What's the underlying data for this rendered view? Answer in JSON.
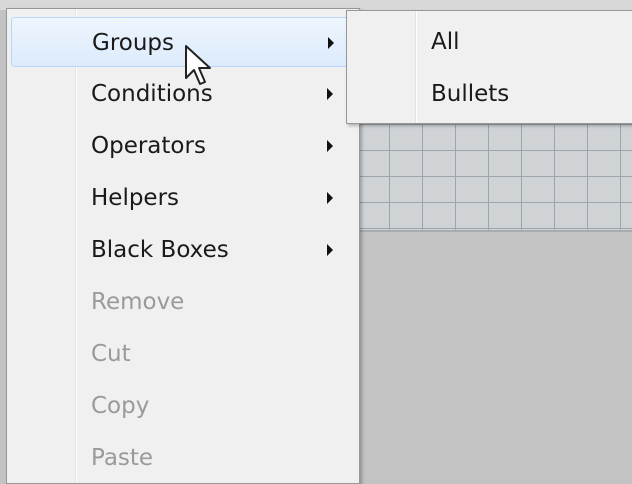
{
  "context_menu": {
    "items": [
      {
        "label": "Groups",
        "has_submenu": true,
        "disabled": false,
        "highlighted": true
      },
      {
        "label": "Conditions",
        "has_submenu": true,
        "disabled": false,
        "highlighted": false
      },
      {
        "label": "Operators",
        "has_submenu": true,
        "disabled": false,
        "highlighted": false
      },
      {
        "label": "Helpers",
        "has_submenu": true,
        "disabled": false,
        "highlighted": false
      },
      {
        "label": "Black Boxes",
        "has_submenu": true,
        "disabled": false,
        "highlighted": false
      },
      {
        "label": "Remove",
        "has_submenu": false,
        "disabled": true,
        "highlighted": false
      },
      {
        "label": "Cut",
        "has_submenu": false,
        "disabled": true,
        "highlighted": false
      },
      {
        "label": "Copy",
        "has_submenu": false,
        "disabled": true,
        "highlighted": false
      },
      {
        "label": "Paste",
        "has_submenu": false,
        "disabled": true,
        "highlighted": false
      }
    ]
  },
  "submenu": {
    "items": [
      {
        "label": "All"
      },
      {
        "label": "Bullets"
      }
    ]
  },
  "colors": {
    "menu_bg": "#f0f0f0",
    "highlight_border": "#b8d6fb",
    "disabled_text": "#9a9a9a",
    "text": "#1a1a1a"
  },
  "icons": {
    "submenu_arrow": "triangle-right-icon",
    "cursor": "mouse-pointer-icon"
  }
}
